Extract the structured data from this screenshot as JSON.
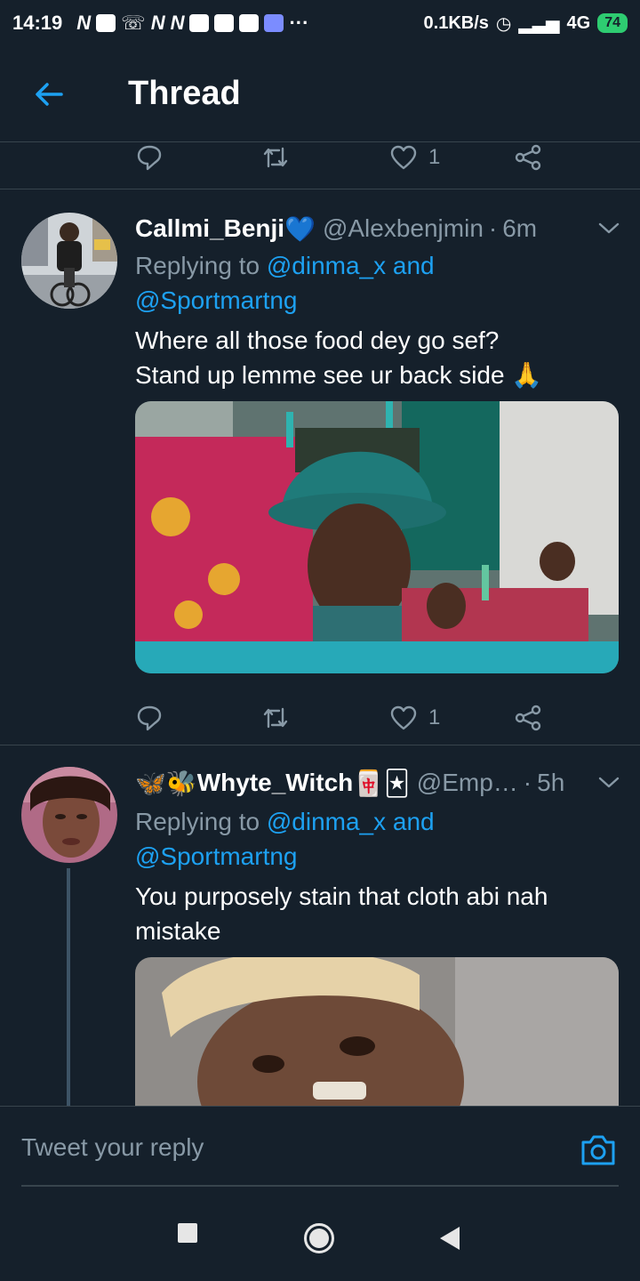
{
  "status_bar": {
    "time": "14:19",
    "net_speed": "0.1KB/s",
    "network": "4G",
    "battery": "74",
    "more": "···"
  },
  "header": {
    "title": "Thread",
    "back_icon": "arrow-left-icon"
  },
  "previous_tweet_actions": {
    "like_count": "1"
  },
  "tweets": [
    {
      "name": "Callmi_Benji",
      "name_emoji": "💙",
      "handle": "@Alexbenjmin",
      "dot": "·",
      "time": "6m",
      "replying_prefix": "Replying to",
      "replying_mention1": "@dinma_x and",
      "replying_mention2": "@Sportmartng",
      "text_line1": "Where all those food dey go sef?",
      "text_line2": "Stand up lemme see ur back side 🙏",
      "like_count": "1"
    },
    {
      "name": "Whyte_Witch",
      "name_prefix_emoji": "🦋🐝",
      "name_suffix_emoji": "🀄🃏",
      "handle": "@Emp…",
      "dot": "·",
      "time": "5h",
      "replying_prefix": "Replying to",
      "replying_mention1": "@dinma_x and",
      "replying_mention2": "@Sportmartng",
      "text_line1": "You purposely stain that cloth abi nah",
      "text_line2": "mistake"
    }
  ],
  "reply_bar": {
    "placeholder": "Tweet your reply"
  },
  "colors": {
    "background": "#15202b",
    "accent": "#1da1f2",
    "secondary_text": "#8899a6",
    "divider": "#38444d"
  }
}
